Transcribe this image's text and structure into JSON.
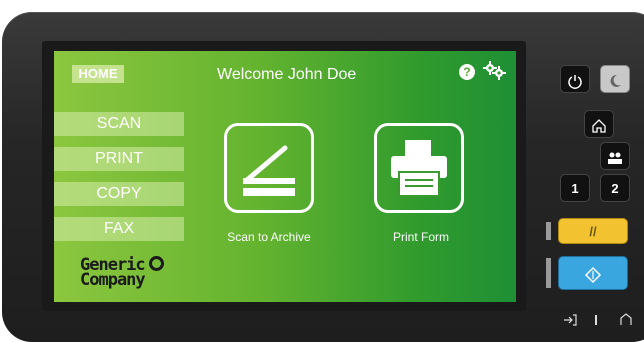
{
  "app": {
    "home_tab": "HOME",
    "welcome": "Welcome John Doe"
  },
  "menu": {
    "items": [
      "SCAN",
      "PRINT",
      "COPY",
      "FAX"
    ]
  },
  "logo": {
    "line1": "Generic",
    "line2": "Company"
  },
  "tiles": [
    {
      "label": "Scan to Archive",
      "icon": "scanner-icon"
    },
    {
      "label": "Print Form",
      "icon": "printer-icon"
    }
  ],
  "hardware": {
    "key1": "1",
    "key2": "2"
  },
  "colors": {
    "screen_start": "#8cc63f",
    "screen_end": "#1f8f35",
    "clear_key": "#f2c230",
    "start_key": "#3aa6e0"
  }
}
